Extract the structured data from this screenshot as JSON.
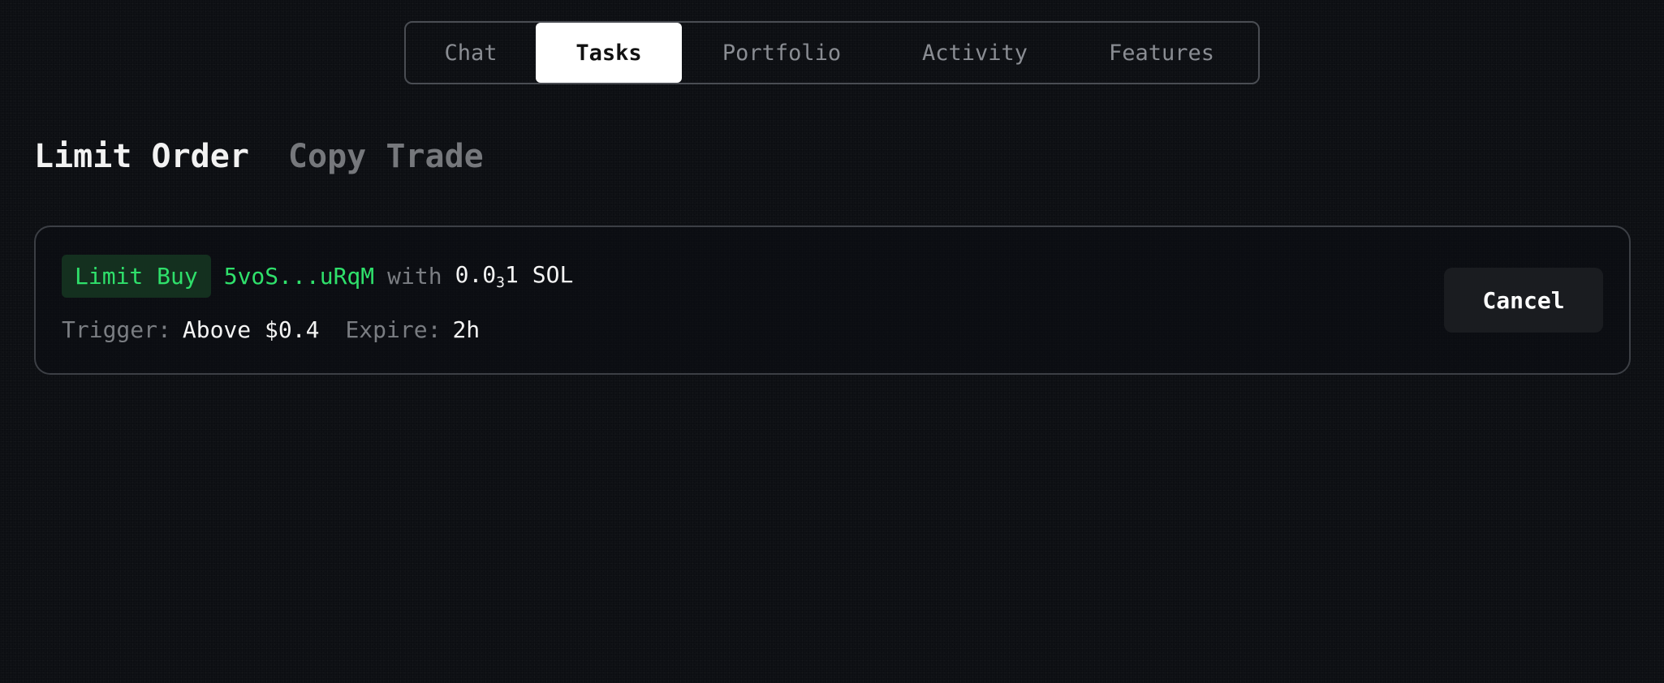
{
  "nav": {
    "tabs": [
      {
        "label": "Chat",
        "active": false
      },
      {
        "label": "Tasks",
        "active": true
      },
      {
        "label": "Portfolio",
        "active": false
      },
      {
        "label": "Activity",
        "active": false
      },
      {
        "label": "Features",
        "active": false
      }
    ]
  },
  "subtabs": {
    "limit_order": "Limit Order",
    "copy_trade": "Copy Trade",
    "active": "Limit Order"
  },
  "order": {
    "type_badge": "Limit Buy",
    "token": "5voS...uRqM",
    "with_text": "with",
    "amount_prefix": "0.0",
    "amount_zero_count": "3",
    "amount_suffix": "1 SOL",
    "trigger_label": "Trigger:",
    "trigger_value": "Above $0.4",
    "expire_label": "Expire:",
    "expire_value": "2h",
    "cancel_label": "Cancel"
  },
  "colors": {
    "background": "#0c0e12",
    "accent_green": "#2fe06b",
    "badge_bg": "#14301f",
    "muted_text": "#7a7d82"
  }
}
